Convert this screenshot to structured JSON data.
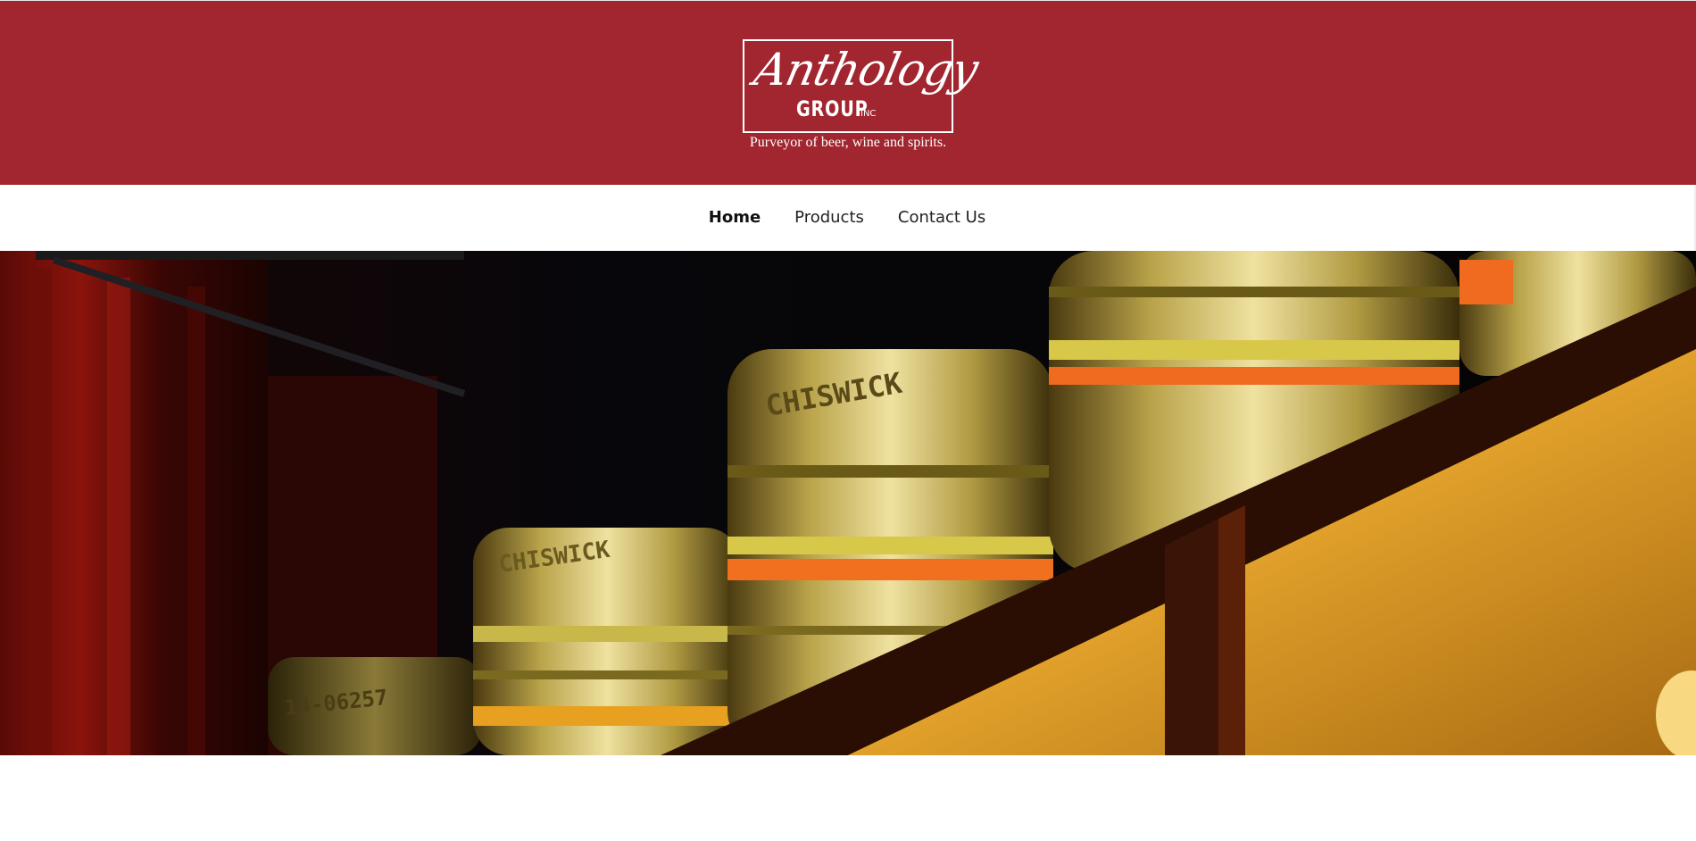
{
  "brand": {
    "name_script": "Anthology",
    "name_group": "GROUP",
    "name_inc": "INC",
    "tagline": "Purveyor of beer, wine and spirits."
  },
  "nav": {
    "items": [
      {
        "label": "Home",
        "active": true
      },
      {
        "label": "Products",
        "active": false
      },
      {
        "label": "Contact Us",
        "active": false
      }
    ]
  },
  "hero": {
    "image_subject": "beer kegs on a lit shelf",
    "keg_text_1": "CHISWICK",
    "keg_text_2": "CHISWICK",
    "keg_text_3": "14-06257"
  },
  "colors": {
    "header_bg": "#a1262f",
    "nav_bg": "#ffffff",
    "nav_text": "#222222"
  }
}
